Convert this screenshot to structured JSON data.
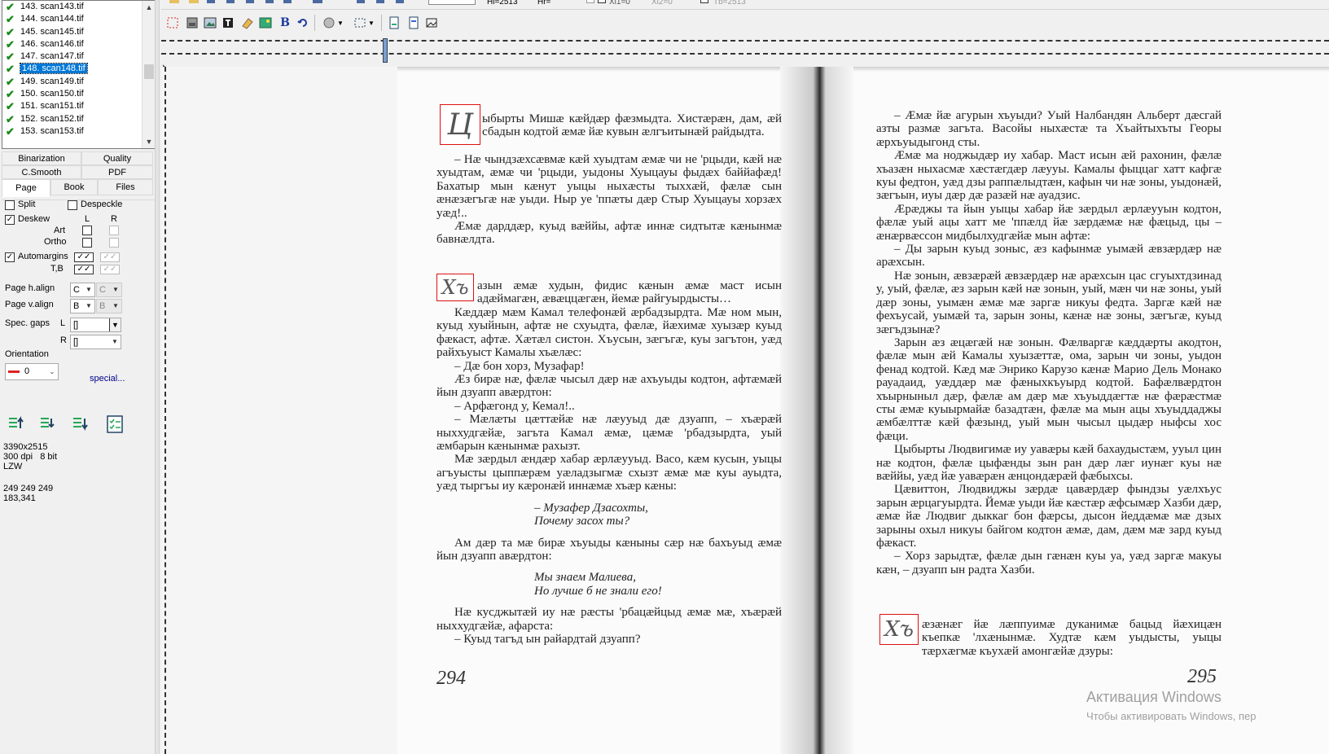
{
  "files": [
    {
      "label": "143. scan143.tif",
      "selected": false
    },
    {
      "label": "144. scan144.tif",
      "selected": false
    },
    {
      "label": "145. scan145.tif",
      "selected": false
    },
    {
      "label": "146. scan146.tif",
      "selected": false
    },
    {
      "label": "147. scan147.tif",
      "selected": false
    },
    {
      "label": "148. scan148.tif",
      "selected": true
    },
    {
      "label": "149. scan149.tif",
      "selected": false
    },
    {
      "label": "150. scan150.tif",
      "selected": false
    },
    {
      "label": "151. scan151.tif",
      "selected": false
    },
    {
      "label": "152. scan152.tif",
      "selected": false
    },
    {
      "label": "153. scan153.tif",
      "selected": false
    }
  ],
  "tabs_top": [
    "Binarization",
    "Quality",
    "C.Smooth",
    "PDF"
  ],
  "tabs_bottom": [
    {
      "label": "Page",
      "active": true
    },
    {
      "label": "Book",
      "active": false
    },
    {
      "label": "Files",
      "active": false
    }
  ],
  "options": {
    "split": "Split",
    "despeckle": "Despeckle",
    "deskew": "Deskew",
    "col_l": "L",
    "col_r": "R",
    "art": "Art",
    "ortho": "Ortho",
    "automargins": "Automargins",
    "tb": "T,B",
    "page_halign": "Page h.align",
    "halign_value": "C",
    "halign_r": "C",
    "page_valign": "Page v.align",
    "valign_value": "B",
    "valign_r": "B",
    "spec_gaps": "Spec. gaps",
    "gap_l_label": "L",
    "gap_l_value": "[]",
    "gap_r_label": "R",
    "gap_r_value": "[]",
    "orientation": "Orientation",
    "orientation_value": "0",
    "special": "special..."
  },
  "image_info": {
    "size": "3390x2515",
    "dpi": "300 dpi   8 bit",
    "compression": "LZW",
    "rgb": "249 249 249",
    "coords": "183,341"
  },
  "toolbar1": {
    "hl": "Hl=2513",
    "hr": "Hr=",
    "xl": "Xl1=0",
    "xr": "Xl2=0",
    "tb": "Tb=2513"
  },
  "book": {
    "left_page_number": "294",
    "right_page_number": "295",
    "left_dropcap1": "Ц",
    "left_dropcap2": "Хъ",
    "right_dropcap": "Хъ",
    "left_p1": "ыбырты Мишæ кæйдæр фæзмыдта. Хистæрæн, дам, æй сбадын кодтой æмæ йæ кувын æлгъитынæй райдыдта.",
    "left_p2": "– Нæ чындзæхсæвмæ кæй хуыдтам æмæ чи не 'рцыди, кæй нæ хуыдтам, æмæ чи 'рцыди, уыдоны Хуыцауы фыдæх баййафæд! Бахатыр мын кæнут уыцы ныхæсты тыххæй, фæлæ сын æнæзæгъгæ нæ уыди. Ныр уе 'ппæты дæр Стыр Хуыцауы хорзæх уæд!..",
    "left_p3": "Æмæ дарддæр, куыд вæййы, афтæ иннæ сидтытæ кæнынмæ бавнæлдта.",
    "left_p4": "азын æмæ худын, фидис кæнын æмæ маст исын адæймагæн, æвæццæгæн, йемæ райгуырдысты…",
    "left_p5": "Кæддæр мæм Камал телефонæй æрбадзырдта. Мæ ном мын, куыд хуыйнын, афтæ не схуыдта, фæлæ, йæхимæ хуызæр куыд фæкаст, афтæ. Хæтæл систон. Хъусын, зæгъгæ, куы загътон, уæд райхъуыст Камалы хъæлæс:",
    "left_p6": "– Дæ бон хорз, Музафар!",
    "left_p7": "Æз бирæ нæ, фæлæ чысыл дæр нæ ахъуыды кодтон, афтæмæй йын дзуапп авæрдтон:",
    "left_p8": "– Арфæгонд у, Кемал!..",
    "left_p9": "– Мæлæты цæттæйæ нæ лæууыд дæ дзуапп, – хъæрæй ныххудгæйæ, загъта Камал æмæ, цæмæ 'рбадзырдта, уый æмбарын кæнынмæ рахызт.",
    "left_p10": "Мæ зæрдыл æндæр хабар æрлæууыд. Васо, кæм кусын, уыцы агъуысты цыппæрæм уæладзыгмæ схызт æмæ мæ куы ауыдта, уæд тыргъы иу кæронæй иннæмæ хъæр кæны:",
    "left_verse1": "– Музафер Дзасохты,",
    "left_verse2": "Почему засох ты?",
    "left_p11": "Ам дæр та мæ бирæ хъуыды кæныны сæр нæ бахъуыд æмæ йын дзуапп авæрдтон:",
    "left_verse3": "Мы знаем Малиева,",
    "left_verse4": "Но лучше б не знали его!",
    "left_p12": "Нæ кусджытæй иу нæ рæсты 'рбацæйцыд æмæ мæ, хъæрæй ныххудгæйæ, афарста:",
    "left_p13": "– Куыд тагъд ын райардтай дзуапп?",
    "right_p1": "– Æмæ йæ агурын хъуыди? Уый Налбандян Альберт дæсгай азты размæ загъта. Васойы ныхæстæ та Хъайтыхъты Георы æрхъуыдыгонд сты.",
    "right_p2": "Æмæ ма ноджыдæр иу хабар. Маст исын æй рахонин, фæлæ хъазæн ныхасмæ хæстæгдæр лæууы. Камалы фыццаг хатт кафгæ куы федтон, уæд дзы раппæлыдтæн, кафын чи нæ зоны, уыдонæй, зæгъын, иуы дæр дæ разæй нæ ауадзис.",
    "right_p3": "Æрæджы та йын уыцы хабар йæ зæрдыл æрлæууын кодтон, фæлæ уый ацы хатт ме 'ппæлд йæ зæрдæмæ нæ фæцыд, цы – æнæрвæссон мидбылхудгæйæ мын афтæ:",
    "right_p4": "– Ды зарын куыд зоныс, æз кафынмæ уымæй æвзæрдæр нæ арæхсын.",
    "right_p5": "Нæ зонын, æвзæрæй æвзæрдæр нæ арæхсын цас сгуыхтдзинад у, уый, фæлæ, æз зарын кæй нæ зонын, уый, мæн чи нæ зоны, уый дæр зоны, уымæн æмæ мæ заргæ никуы федта. Заргæ кæй нæ фехъусай, уымæй та, зарын зоны, кæнæ нæ зоны, зæгъгæ, куыд зæгъдзынæ?",
    "right_p6": "Зарын æз æцæгæй нæ зонын. Фæлваргæ кæддæрты акодтон, фæлæ мын æй Камалы хуызæттæ, ома, зарын чи зоны, уыдон фенад кодтой. Кæд мæ Энрико Карузо кæнæ Марио Дель Монако рауадаид, уæддæр мæ фæныхкъуырд кодтой. Бафæлвæрдтон хъырныныл дæр, фæлæ ам дæр мæ хъуыддæгтæ нæ фæрæстмæ сты æмæ куыырмайæ базадтæн, фæлæ ма мын ацы хъуыддаджы æмбæлттæ кæй фæзынд, уый мын чысыл цыдæр ныфсы хос фæци.",
    "right_p7": "Цыбырты Людвигимæ иу уавæры кæй бахаудыстæм, ууыл цин нæ кодтон, фæлæ цыфæнды зын ран дæр лæг иунæг куы нæ вæййы, уæд йæ уавæрæн æнцондæрæй фæбыхсы.",
    "right_p8": "Цæвиттон, Людвиджы зæрдæ цавæрдæр фындзы уæлхъус зарын æрцагуырдта. Йемæ уыди йæ кæстæр æфсымæр Хазби дæр, æмæ йæ Людвиг дыккаг бон фæрсы, дысон йеддæмæ мæ дзых зарыны охыл никуы байгом кодтон æмæ, дам, дæм мæ зард куыд фæкаст.",
    "right_p9": "– Хорз зарыдтæ, фæлæ дын гæнæн куы уа, уæд заргæ макуы кæн, – дзуапп ын радта Хазби.",
    "right_p10": "æзæнæг йæ лæппуимæ дуканимæ бацыд йæхицæн къепкæ 'лхæнынмæ. Худтæ кæм уыдысты, уыцы тæрхæгмæ къухæй амонгæйæ дзуры:"
  },
  "watermark": {
    "line1": "Активация Windows",
    "line2": "Чтобы активировать Windows, пер"
  }
}
